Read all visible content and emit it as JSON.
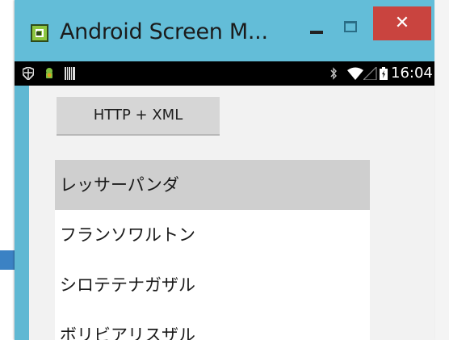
{
  "window": {
    "title": "Android Screen M...",
    "close_glyph": "✕"
  },
  "statusbar": {
    "time": "16:04",
    "icons": [
      "shield-icon",
      "android-icon",
      "barcode-icon",
      "bluetooth-icon",
      "wifi-icon",
      "signal-icon",
      "battery-icon"
    ]
  },
  "main": {
    "button_label": "HTTP + XML",
    "list": [
      {
        "label": "レッサーパンダ",
        "selected": true
      },
      {
        "label": "フランソワルトン",
        "selected": false
      },
      {
        "label": "シロテテナガザル",
        "selected": false
      },
      {
        "label": "ボリビアリスザル",
        "selected": false
      }
    ]
  },
  "colors": {
    "titlebar": "#63bdd8",
    "close": "#c9443f",
    "selected_row": "#cfcfcf",
    "arrow": "#3b82c4"
  }
}
